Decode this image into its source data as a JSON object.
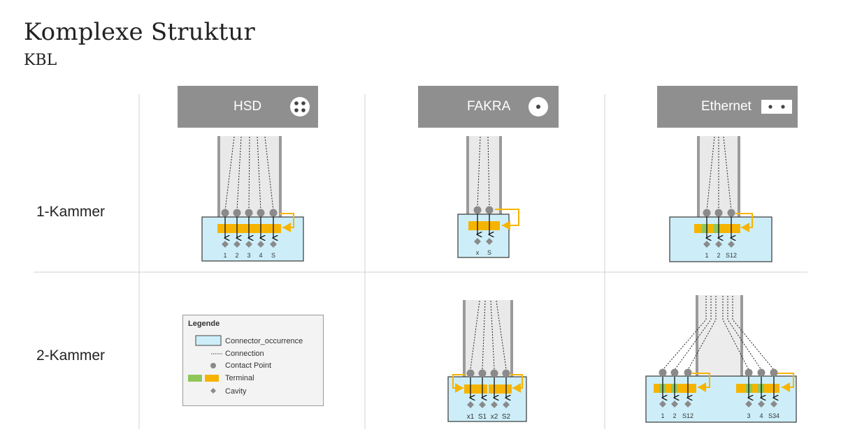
{
  "title": "Komplexe Struktur",
  "subtitle": "KBL",
  "rows": [
    "1-Kammer",
    "2-Kammer"
  ],
  "columns": [
    "HSD",
    "FAKRA",
    "Ethernet"
  ],
  "labels": {
    "hsd_1": [
      "1",
      "2",
      "3",
      "4",
      "S"
    ],
    "fakra_1": [
      "x",
      "S"
    ],
    "eth_1": [
      "1",
      "2",
      "S12"
    ],
    "fakra_2": [
      "x1",
      "S1",
      "x2",
      "S2"
    ],
    "eth_2": [
      "1",
      "2",
      "S12",
      "3",
      "4",
      "S34"
    ]
  },
  "legend": {
    "title": "Legende",
    "items": [
      "Connector_occurrence",
      "Connection",
      "Contact Point",
      "Terminal",
      "Cavity"
    ]
  },
  "colors": {
    "header": "#8f8f8f",
    "connector_fill": "#cdeef9",
    "terminal_orange": "#f6b400",
    "terminal_green": "#8fc75a",
    "contact_gray": "#8a8a8a"
  }
}
